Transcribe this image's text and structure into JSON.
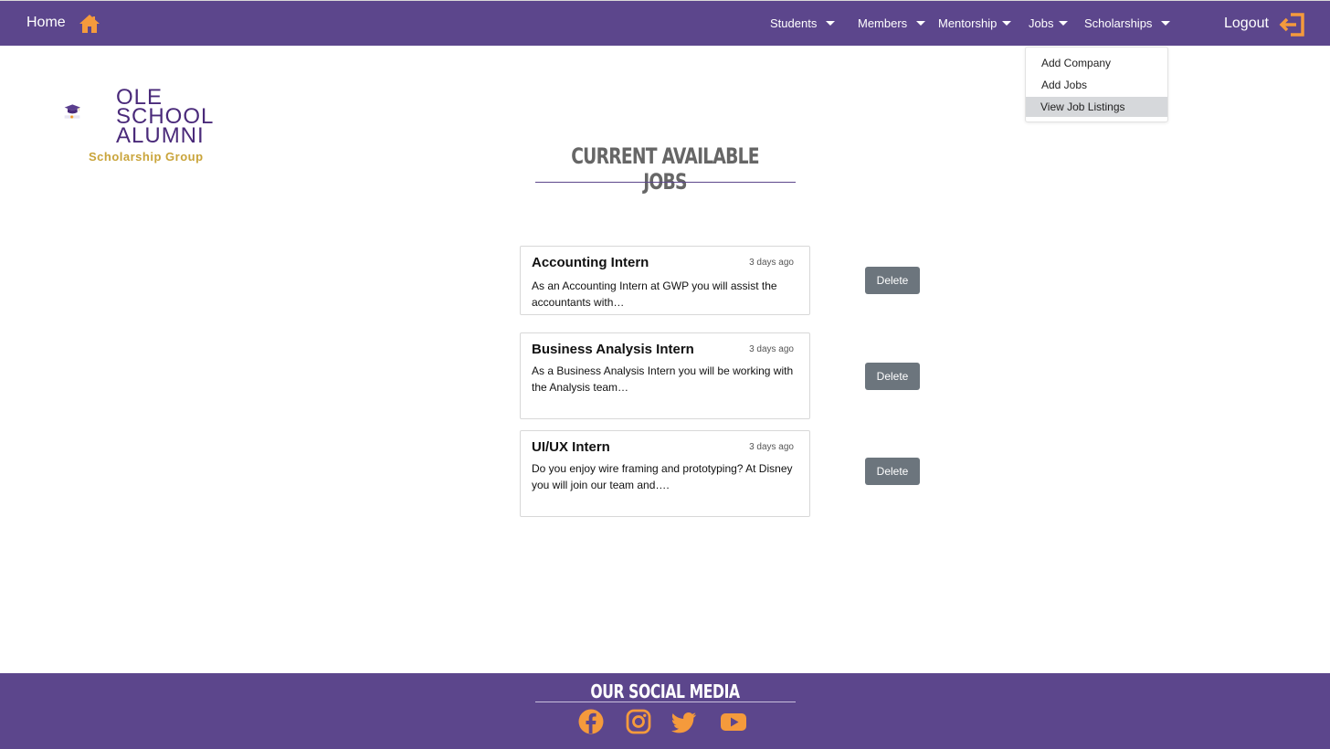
{
  "nav": {
    "home_label": "Home",
    "menus": [
      {
        "label": "Students"
      },
      {
        "label": "Members"
      },
      {
        "label": "Mentorship"
      },
      {
        "label": "Jobs"
      },
      {
        "label": "Scholarships"
      }
    ],
    "logout_label": "Logout"
  },
  "dropdown": {
    "items": [
      {
        "label": "Add Company"
      },
      {
        "label": "Add Jobs"
      },
      {
        "label": "View Job Listings",
        "active": true
      }
    ]
  },
  "logo": {
    "line1": "OLE",
    "line2": "SCHOOL",
    "line3": "ALUMNI",
    "subtitle": "Scholarship Group"
  },
  "page": {
    "title": "CURRENT AVAILABLE JOBS"
  },
  "jobs": [
    {
      "title": "Accounting Intern",
      "posted": "3 days ago",
      "description": "As an Accounting Intern at GWP you will assist the accountants with…",
      "action": "Delete"
    },
    {
      "title": "Business Analysis Intern",
      "posted": "3 days ago",
      "description": "As a Business Analysis Intern you will be working with the Analysis team…",
      "action": "Delete"
    },
    {
      "title": "UI/UX Intern",
      "posted": "3 days ago",
      "description": "Do you enjoy wire framing and prototyping? At Disney you will join our team and….",
      "action": "Delete"
    }
  ],
  "footer": {
    "title": "OUR SOCIAL MEDIA",
    "icons": [
      "facebook-icon",
      "instagram-icon",
      "twitter-icon",
      "youtube-icon"
    ]
  },
  "colors": {
    "brand_purple": "#5c468c",
    "accent_orange": "#f59a3c",
    "button_gray": "#6c757d",
    "logo_gold": "#c9a43a"
  }
}
